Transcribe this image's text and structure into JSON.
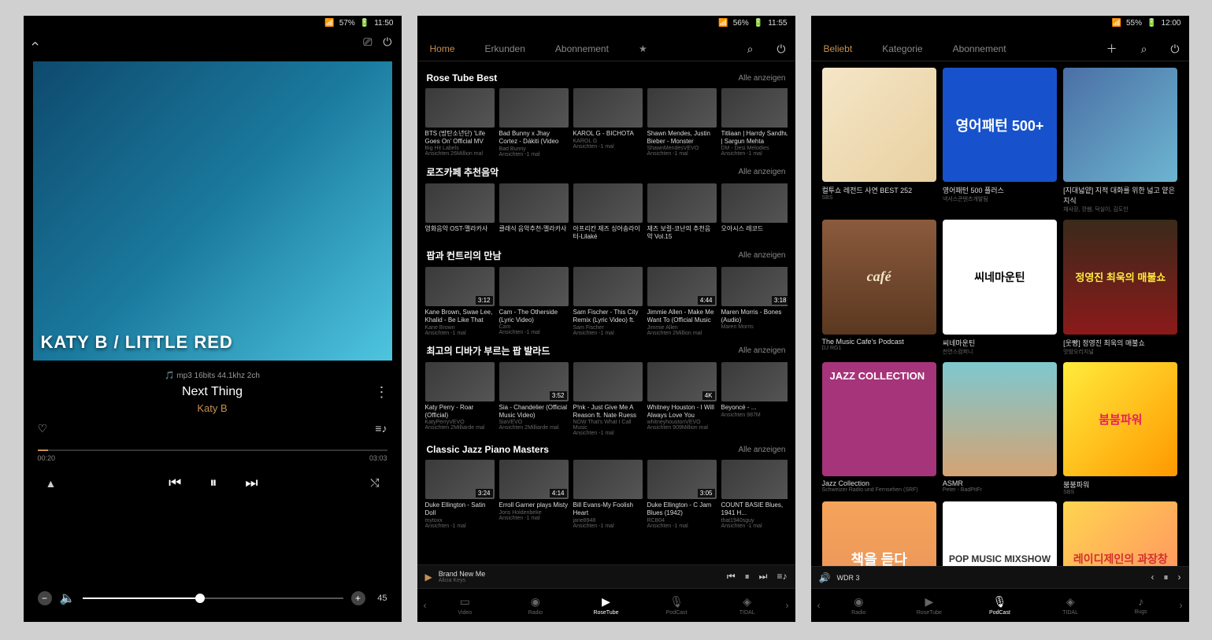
{
  "screen1": {
    "status": {
      "battery": "57%",
      "time": "11:50"
    },
    "album_text": "KATY B / LITTLE RED",
    "format": "mp3 16bits 44.1khz 2ch",
    "track": "Next Thing",
    "artist": "Katy B",
    "time_current": "00:20",
    "time_total": "03:03",
    "volume": "45"
  },
  "screen2": {
    "status": {
      "battery": "56%",
      "time": "11:55"
    },
    "tabs": [
      "Home",
      "Erkunden",
      "Abonnement",
      "★"
    ],
    "all_label": "Alle anzeigen",
    "sections": [
      {
        "title": "Rose Tube Best",
        "items": [
          {
            "title": "BTS (방탄소년단) 'Life Goes On' Official MV",
            "sub": "Big Hit Labels",
            "views": "Ansichten 26Million mal",
            "dur": ""
          },
          {
            "title": "Bad Bunny x Jhay Cortez - Dákiti (Video Oficial)",
            "sub": "Bad Bunny",
            "views": "Ansichten -1 mal",
            "dur": ""
          },
          {
            "title": "KAROL G - BICHOTA",
            "sub": "KAROL G",
            "views": "Ansichten -1 mal",
            "dur": ""
          },
          {
            "title": "Shawn Mendes, Justin Bieber - Monster",
            "sub": "ShawnMendesVEVO",
            "views": "Ansichten -1 mal",
            "dur": ""
          },
          {
            "title": "Titliaan | Harrdy Sandhu | Sargun Mehta",
            "sub": "DM - Desi Melodies",
            "views": "Ansichten -1 mal",
            "dur": ""
          }
        ]
      },
      {
        "title": "로즈카페 추천음악",
        "items": [
          {
            "title": "영화음악 OST-멜라카사",
            "sub": "",
            "views": "",
            "dur": ""
          },
          {
            "title": "클래식 음악추천-멜라카사",
            "sub": "",
            "views": "",
            "dur": ""
          },
          {
            "title": "아프리칸 재즈 싱어송라이터-Lilaké",
            "sub": "",
            "views": "",
            "dur": ""
          },
          {
            "title": "재즈 보컬-코난의 추천음악 Vol.15",
            "sub": "",
            "views": "",
            "dur": ""
          },
          {
            "title": "오아시스 레코드",
            "sub": "",
            "views": "",
            "dur": ""
          }
        ]
      },
      {
        "title": "팝과 컨트리의 만남",
        "items": [
          {
            "title": "Kane Brown, Swae Lee, Khalid - Be Like That (feat. ...",
            "sub": "Kane Brown",
            "views": "Ansichten -1 mal",
            "dur": "3:12"
          },
          {
            "title": "Cam - The Otherside (Lyric Video)",
            "sub": "Cam",
            "views": "Ansichten -1 mal",
            "dur": ""
          },
          {
            "title": "Sam Fischer - This City Remix (Lyric Video) ft. Kane",
            "sub": "Sam Fischer",
            "views": "Ansichten -1 mal",
            "dur": ""
          },
          {
            "title": "Jimmie Allen - Make Me Want To (Official Music Vid...",
            "sub": "Jimmie Allen",
            "views": "Ansichten 2Million mal",
            "dur": "4:44"
          },
          {
            "title": "Maren Morris - Bones (Audio)",
            "sub": "Maren Morris",
            "views": "",
            "dur": "3:18"
          }
        ]
      },
      {
        "title": "최고의 디바가 부르는 팝 발라드",
        "items": [
          {
            "title": "Katy Perry - Roar (Official)",
            "sub": "KatyPerryVEVO",
            "views": "Ansichten 2Milliarde mal",
            "dur": ""
          },
          {
            "title": "Sia - Chandelier (Official Music Video)",
            "sub": "SiaVEVO",
            "views": "Ansichten 2Milliarde mal",
            "dur": "3:52"
          },
          {
            "title": "P!nk - Just Give Me A Reason ft. Nate Ruess",
            "sub": "NOW That's What I Call Music",
            "views": "Ansichten -1 mal",
            "dur": ""
          },
          {
            "title": "Whitney Houston - I Will Always Love You",
            "sub": "whitneyhoustonVEVO",
            "views": "Ansichten 909Million mal",
            "dur": "4K"
          },
          {
            "title": "Beyoncé - ...",
            "sub": "",
            "views": "Ansichten 987M",
            "dur": ""
          }
        ]
      },
      {
        "title": "Classic Jazz Piano Masters",
        "items": [
          {
            "title": "Duke Ellington - Satin Doll",
            "sub": "mytoxx",
            "views": "Ansichten -1 mal",
            "dur": "3:24"
          },
          {
            "title": "Erroll Garner plays Misty",
            "sub": "Joris Holdenbeke",
            "views": "Ansichten -1 mal",
            "dur": "4:14"
          },
          {
            "title": "Bill Evans-My Foolish Heart",
            "sub": "jane8948",
            "views": "Ansichten -1 mal",
            "dur": ""
          },
          {
            "title": "Duke Ellington - C Jam Blues (1942)",
            "sub": "RCB04",
            "views": "Ansichten -1 mal",
            "dur": "3:05"
          },
          {
            "title": "COUNT BASIE Blues, 1941 H...",
            "sub": "that1940sguy",
            "views": "Ansichten -1 mal",
            "dur": ""
          }
        ]
      }
    ],
    "miniplayer": {
      "title": "Brand New Me",
      "artist": "Alicia Keys"
    },
    "nav": [
      "Video",
      "Radio",
      "RoseTube",
      "PodCast",
      "TIDAL"
    ]
  },
  "screen3": {
    "status": {
      "battery": "55%",
      "time": "12:00"
    },
    "tabs": [
      "Beliebt",
      "Kategorie",
      "Abonnement"
    ],
    "cards": [
      {
        "title": "컬투쇼 레전드 사연 BEST 252",
        "sub": "SBS",
        "art": "",
        "cls": "c1"
      },
      {
        "title": "영어패턴 500 플러스",
        "sub": "넥서스콘텐츠개발팀",
        "art": "영어패턴 500+",
        "cls": "c2"
      },
      {
        "title": "[지대넓얕] 지적 대화를 위한 넓고 얕은 지식",
        "sub": "채사장, 깡쌤, 덕실이, 김도인",
        "art": "",
        "cls": "c3"
      },
      {
        "title": "The Music Cafe's Podcast",
        "sub": "DJ RG1",
        "art": "café",
        "cls": "c4"
      },
      {
        "title": "씨네마운틴",
        "sub": "천연스컴퍼니",
        "art": "씨네마운틴",
        "cls": "c5"
      },
      {
        "title": "[웃빵] 정영진 최욱의 매불쇼",
        "sub": "맛밤오리지널",
        "art": "정영진 최욱의 매불쇼",
        "cls": "c6"
      },
      {
        "title": "Jazz Collection",
        "sub": "Schweizer Radio und Fernsehen (SRF)",
        "art": "JAZZ COLLECTION",
        "cls": "c7"
      },
      {
        "title": "ASMR",
        "sub": "Peter - BadPitFr",
        "art": "",
        "cls": "c8"
      },
      {
        "title": "붐붐파워",
        "sub": "SBS",
        "art": "붐붐파워",
        "cls": "c9"
      },
      {
        "title": "",
        "sub": "",
        "art": "책을 듣다",
        "cls": "c10"
      },
      {
        "title": "",
        "sub": "",
        "art": "POP MUSIC MIXSHOW",
        "cls": "c11"
      },
      {
        "title": "",
        "sub": "",
        "art": "레이디제인의 과장창",
        "cls": "c12"
      }
    ],
    "miniplayer": {
      "title": "WDR 3",
      "artist": ""
    },
    "nav": [
      "Radio",
      "RoseTube",
      "PodCast",
      "TIDAL",
      "Bugs"
    ]
  }
}
